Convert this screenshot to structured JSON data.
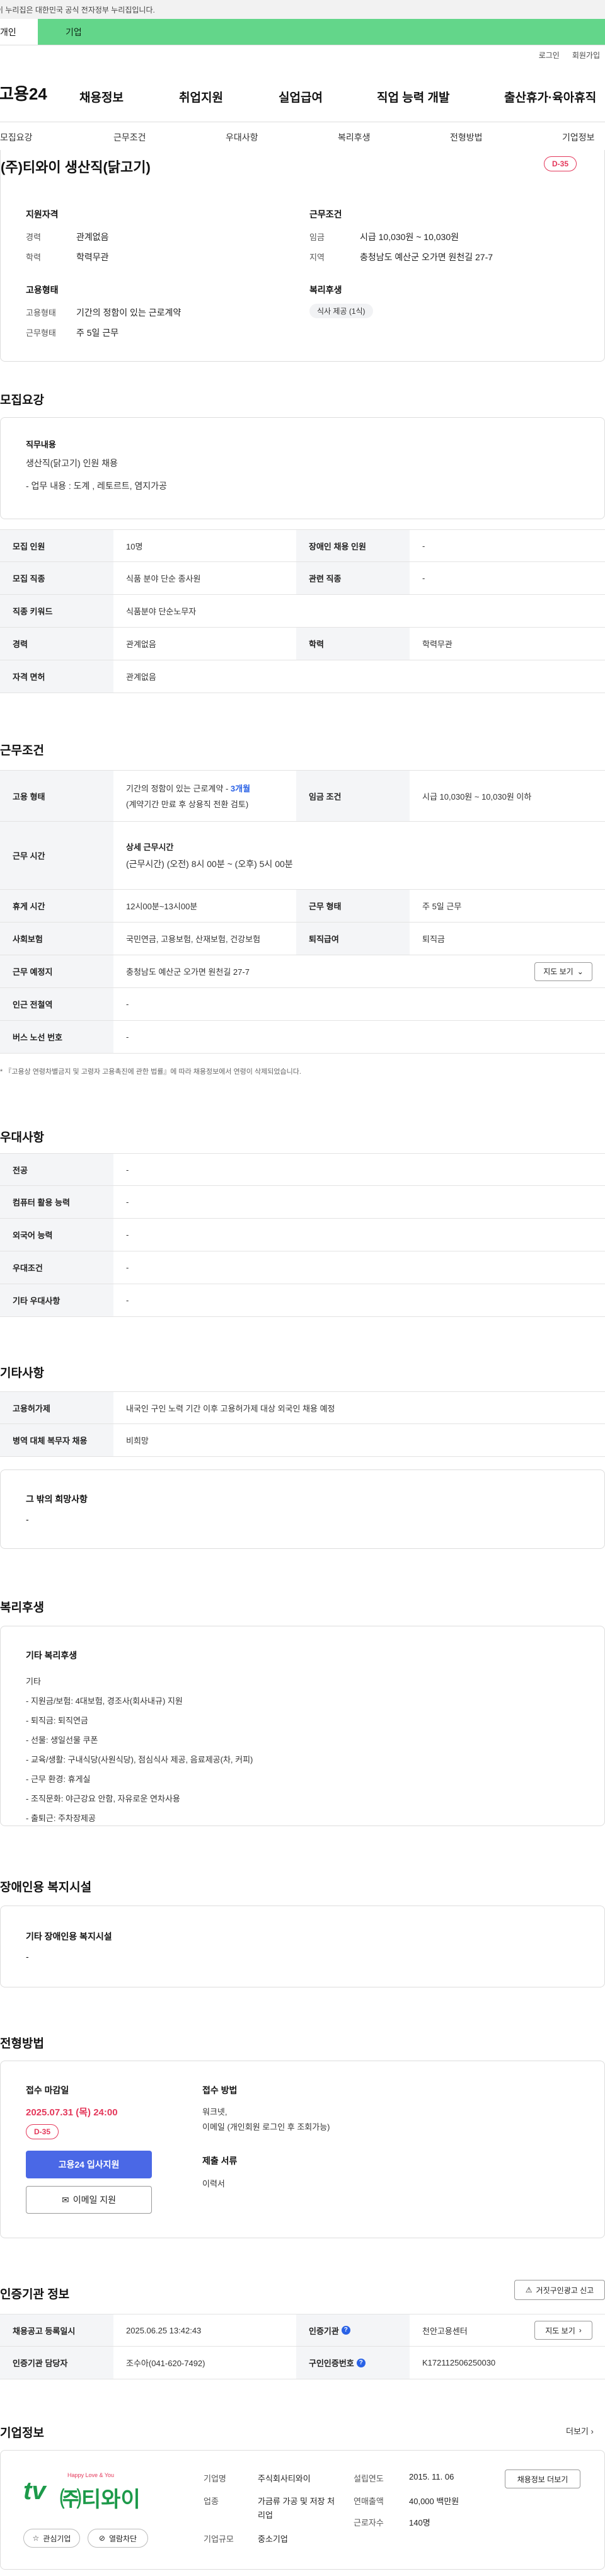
{
  "gov_banner": "이 누리집은 대한민국 공식 전자정부 누리집입니다.",
  "top_tabs": [
    "개인",
    "기업"
  ],
  "util_links": [
    "로그인",
    "회원가입"
  ],
  "logo": "고용24",
  "gnb": [
    "채용정보",
    "취업지원",
    "실업급여",
    "직업 능력 개발",
    "출산휴가·육아휴직"
  ],
  "subtabs": [
    "모집요강",
    "근무조건",
    "우대사항",
    "복리후생",
    "전형방법",
    "기업정보"
  ],
  "job_title": "(주)티와이 생산직(닭고기)",
  "dday": "D-35",
  "summary": {
    "qual_title": "지원자격",
    "career_label": "경력",
    "career_value": "관계없음",
    "edu_label": "학력",
    "edu_value": "학력무관",
    "cond_title": "근무조건",
    "wage_label": "임금",
    "wage_value": "시급 10,030원 ~ 10,030원",
    "region_label": "지역",
    "region_value": "충청남도 예산군 오가면 원천길 27-7",
    "emp_title": "고용형태",
    "emp_type_label": "고용형태",
    "emp_type_value": "기간의 정함이 있는 근로계약",
    "work_type_label": "근무형태",
    "work_type_value": "주 5일 근무",
    "welfare_title": "복리후생",
    "welfare_tag": "식사 제공 (1식)"
  },
  "recruit": {
    "title": "모집요강",
    "duty_title": "직무내용",
    "duty_line1": "생산직(닭고기) 인원 채용",
    "duty_line2": "- 업무 내용 : 도계 , 레토르트, 염지가공",
    "rows": [
      {
        "l1": "모집 인원",
        "v1": "10명",
        "l2": "장애인 채용 인원",
        "v2": "-"
      },
      {
        "l1": "모집 직종",
        "v1": "식품 분야 단순 종사원",
        "l2": "관련 직종",
        "v2": "-"
      },
      {
        "l1": "직종 키워드",
        "v1": "식품분야 단순노무자"
      },
      {
        "l1": "경력",
        "v1": "관계없음",
        "l2": "학력",
        "v2": "학력무관"
      },
      {
        "l1": "자격 면허",
        "v1": "관계없음"
      }
    ]
  },
  "work": {
    "title": "근무조건",
    "emp_label": "고용 형태",
    "emp_value": "기간의 정함이 있는 근로계약 - ",
    "emp_value_blue": "3개월",
    "emp_note": "(계약기간 만료 후 상용직 전환 검토)",
    "wage_label": "임금 조건",
    "wage_value": "시급 10,030원 ~ 10,030원 이하",
    "hours_label": "근무 시간",
    "hours_title": "상세 근무시간",
    "hours_value": "(근무시간) (오전) 8시 00분 ~ (오후) 5시 00분",
    "break_label": "휴게 시간",
    "break_value": "12시00분~13시00분",
    "shape_label": "근무 형태",
    "shape_value": "주 5일 근무",
    "ins_label": "사회보험",
    "ins_value": "국민연금, 고용보험, 산재보험, 건강보험",
    "retire_label": "퇴직급여",
    "retire_value": "퇴직금",
    "place_label": "근무 예정지",
    "place_value": "충청남도 예산군 오가면 원천길 27-7",
    "map_btn": "지도 보기",
    "subway_label": "인근 전철역",
    "subway_value": "-",
    "bus_label": "버스 노선 번호",
    "bus_value": "-",
    "footnote": "* 『고용상 연령차별금지 및 고령자 고용촉진에 관한 법률』에 따라 채용정보에서 연령이 삭제되었습니다."
  },
  "pref": {
    "title": "우대사항",
    "rows": [
      {
        "l": "전공",
        "v": "-"
      },
      {
        "l": "컴퓨터 활용 능력",
        "v": "-"
      },
      {
        "l": "외국어 능력",
        "v": "-"
      },
      {
        "l": "우대조건",
        "v": "-"
      },
      {
        "l": "기타 우대사항",
        "v": "-"
      }
    ]
  },
  "etc": {
    "title": "기타사항",
    "rows": [
      {
        "l": "고용허가제",
        "v": "내국인 구인 노력 기간 이후 고용허가제 대상 외국인 채용 예정"
      },
      {
        "l": "병역 대체 복무자 채용",
        "v": "비희망"
      }
    ],
    "other_title": "그 밖의 희망사항",
    "other_value": "-"
  },
  "welfare": {
    "title": "복리후생",
    "box_title": "기타 복리후생",
    "lines": [
      "기타",
      "- 지원금/보험: 4대보험, 경조사(회사내규) 지원",
      "- 퇴직금: 퇴직연금",
      "- 선물: 생일선물 쿠폰",
      "- 교육/생활: 구내식당(사원식당), 점심식사 제공, 음료제공(차, 커피)",
      "- 근무 환경: 휴게실",
      "- 조직문화: 야근강요 안함, 자유로운 연차사용",
      "- 출퇴근: 주차장제공"
    ]
  },
  "disabled": {
    "title": "장애인용 복지시설",
    "box_title": "기타 장애인용 복지시설",
    "value": "-"
  },
  "apply": {
    "title": "전형방법",
    "deadline_label": "접수 마감일",
    "deadline": "2025.07.31 (목) 24:00",
    "dday": "D-35",
    "apply_btn": "고용24 입사지원",
    "email_btn": "이메일 지원",
    "method_label": "접수 방법",
    "method_v1": "워크넷,",
    "method_v2": "이메일 (개인회원 로그인 후 조회가능)",
    "docs_label": "제출 서류",
    "docs_value": "이력서"
  },
  "cert": {
    "title": "인증기관 정보",
    "report_btn": "거짓구인광고 신고",
    "reg_label": "채용공고 등록일시",
    "reg_value": "2025.06.25 13:42:43",
    "org_label": "인증기관",
    "org_value": "천안고용센터",
    "map_btn": "지도 보기",
    "mgr_label": "인증기관 담당자",
    "mgr_value": "조수아(041-620-7492)",
    "no_label": "구인인증번호",
    "no_value": "K172112506250030"
  },
  "company": {
    "title": "기업정보",
    "more": "더보기",
    "logo_text": "㈜티와이",
    "logo_small": "tv",
    "logo_tag": "Happy Love & You",
    "fav_btn": "관심기업",
    "block_btn": "열람차단",
    "name_label": "기업명",
    "name_value": "주식회사티와이",
    "industry_label": "업종",
    "industry_value": "가금류 가공 및 저장 처리업",
    "size_label": "기업규모",
    "size_value": "중소기업",
    "est_label": "설립연도",
    "est_value": "2015. 11. 06",
    "sales_label": "연매출액",
    "sales_value": "40,000 백만원",
    "staff_label": "근로자수",
    "staff_value": "140명",
    "notice_btn": "채용정보 더보기"
  },
  "colors": {
    "accent_blue": "#2a62e6",
    "dday_red": "#e4385b",
    "tab_green": "#63d68a"
  }
}
